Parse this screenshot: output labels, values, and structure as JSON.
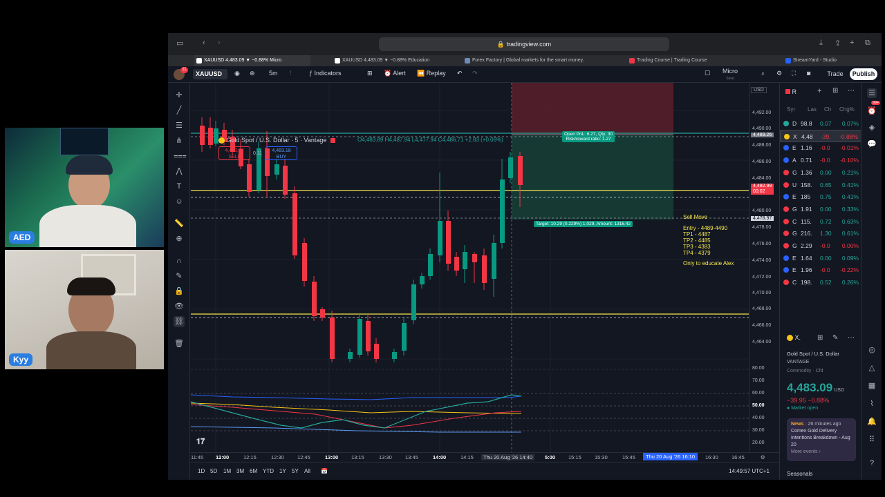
{
  "cams": {
    "cam1_label": "AED",
    "cam2_label": "Kyy"
  },
  "browser": {
    "url": "tradingview.com",
    "tabs": [
      {
        "label": "XAUUSD 4,483.09 ▼ −0.88% Micro",
        "active": true
      },
      {
        "label": "XAUUSD 4,483.09 ▼ −0.88% Education",
        "active": false
      },
      {
        "label": "Forex Factory | Global markets for the smart money.",
        "active": false
      },
      {
        "label": "Trading Course | Trading Course",
        "active": false
      },
      {
        "label": "StreamYard - Studio",
        "active": false
      }
    ]
  },
  "toolbar": {
    "notif_count": "11",
    "symbol": "XAUUSD",
    "interval": "5m",
    "indicators": "Indicators",
    "alert": "Alert",
    "replay": "Replay",
    "layout_name": "Micro",
    "layout_sub": "Save",
    "trade": "Trade",
    "publish": "Publish"
  },
  "legend": {
    "title": "Gold Spot / U.S. Dollar · 5 · Vantage",
    "ohlc": "O4,483.89 H4,487.94 L4,477.94 C4,486.71 +2.83 (+0.06%)",
    "sell_price": "4,483.07",
    "sell_label": "SELL",
    "spread": "0.11",
    "buy_price": "4,483.18",
    "buy_label": "BUY",
    "currency": "USD"
  },
  "price_axis": {
    "labels": [
      "4,492.00",
      "4,490.00",
      "4,488.00",
      "4,486.00",
      "4,484.00",
      "4,480.00",
      "4,478.00",
      "4,476.00",
      "4,474.00",
      "4,472.00",
      "4,470.00",
      "4,468.00",
      "4,466.00",
      "4,464.00"
    ],
    "marker_top": "4,489.26",
    "marker_current": "4,482.99",
    "marker_countdown": "00:02",
    "marker_stop": "4,478.97",
    "rsi_labels": [
      "80.00",
      "70.00",
      "60.00",
      "50.00",
      "40.00",
      "30.00",
      "20.00"
    ]
  },
  "time_axis": {
    "labels": [
      "11:45",
      "12:00",
      "12:15",
      "12:30",
      "12:45",
      "13:00",
      "13:15",
      "13:30",
      "13:45",
      "14:00",
      "14:15",
      "14:40",
      "5:00",
      "15:15",
      "15:30",
      "15:45",
      "16:30",
      "16:45"
    ],
    "cursor_label": "Thu 20 Aug '26",
    "cursor_label_2": "Thu 20 Aug '26   16:10"
  },
  "bottom_bar": {
    "ranges": [
      "1D",
      "5D",
      "1M",
      "3M",
      "6M",
      "YTD",
      "1Y",
      "5Y",
      "All"
    ],
    "clock": "14:49:57 UTC+1"
  },
  "position": {
    "open_label": "Open PnL: 6.27, Qty: 30",
    "rr_label": "Risk/reward ratio: 1.27",
    "target_label": "Target: 10.29 (0.229%) 1,029, Amount: 1316.42"
  },
  "annotation": {
    "title": "Sell Move",
    "lines": [
      "Entry - 4489-4490",
      "TP1 - 4487",
      "TP2 - 4485",
      "TP3 - 4383",
      "TP4 - 4379"
    ],
    "note": "Only to educate Alex"
  },
  "watchlist": {
    "title": "R",
    "headers": {
      "sym": "Syr",
      "last": "Las",
      "chg": "Ch",
      "pct": "Chg%"
    },
    "rows": [
      {
        "sym": "D",
        "last": "98.8",
        "chg": "0.07",
        "pct": "0.07%",
        "color": "#26a69a",
        "dir": "pos"
      },
      {
        "sym": "X",
        "last": "4,48",
        "chg": "-39.",
        "pct": "-0.88%",
        "color": "#f5c518",
        "dir": "neg",
        "sel": true
      },
      {
        "sym": "E",
        "last": "1.16",
        "chg": "-0.0",
        "pct": "-0.01%",
        "color": "#2962ff",
        "dir": "neg"
      },
      {
        "sym": "A",
        "last": "0.71",
        "chg": "-0.0",
        "pct": "-0.10%",
        "color": "#2962ff",
        "dir": "neg"
      },
      {
        "sym": "G",
        "last": "1.36",
        "chg": "0.00",
        "pct": "0.21%",
        "color": "#f23645",
        "dir": "pos"
      },
      {
        "sym": "U",
        "last": "158.",
        "chg": "0.65",
        "pct": "0.41%",
        "color": "#f23645",
        "dir": "pos"
      },
      {
        "sym": "E",
        "last": "185",
        "chg": "0.75",
        "pct": "0.41%",
        "color": "#2962ff",
        "dir": "pos"
      },
      {
        "sym": "G",
        "last": "1.91",
        "chg": "0.00",
        "pct": "0.33%",
        "color": "#f23645",
        "dir": "pos"
      },
      {
        "sym": "C",
        "last": "115.",
        "chg": "0.72",
        "pct": "0.63%",
        "color": "#f23645",
        "dir": "pos"
      },
      {
        "sym": "G",
        "last": "216.",
        "chg": "1.30",
        "pct": "0.61%",
        "color": "#f23645",
        "dir": "pos"
      },
      {
        "sym": "G",
        "last": "2.29",
        "chg": "-0.0",
        "pct": "0.00%",
        "color": "#f23645",
        "dir": "neg"
      },
      {
        "sym": "E",
        "last": "1.64",
        "chg": "0.00",
        "pct": "0.09%",
        "color": "#2962ff",
        "dir": "pos"
      },
      {
        "sym": "E",
        "last": "1.96",
        "chg": "-0.0",
        "pct": "-0.22%",
        "color": "#2962ff",
        "dir": "neg"
      },
      {
        "sym": "C",
        "last": "198.",
        "chg": "0.52",
        "pct": "0.26%",
        "color": "#f23645",
        "dir": "pos"
      }
    ]
  },
  "details": {
    "symbol_short": "X.",
    "name": "Gold Spot / U.S. Dollar",
    "exchange": "VANTAGE",
    "category": "Commodity · Cfd",
    "price": "4,483.09",
    "currency": "USD",
    "change": "−39.95  −0.88%",
    "market_status": "Market open",
    "news_tag": "News",
    "news_time": "· 26 minutes ago",
    "news_title": "Comex Gold Delivery Intentions Breakdown - Aug 20",
    "more_events": "More events ›",
    "seasonals": "Seasonals"
  },
  "right_icons": {
    "badge": "99+"
  },
  "colors": {
    "bull": "#089981",
    "bear": "#f23645",
    "bg": "#131722",
    "accent": "#2962ff",
    "annotation": "#f5e74b"
  }
}
